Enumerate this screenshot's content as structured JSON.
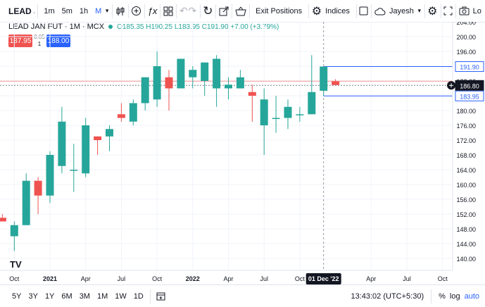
{
  "toolbar": {
    "symbol": "LEAD JAN FL",
    "intervals": [
      "1m",
      "5m",
      "1h",
      "M"
    ],
    "active_interval": "M",
    "exit_positions": "Exit Positions",
    "indices": "Indices",
    "user": "Jayesh",
    "log_label": "Lo",
    "icons": [
      "candles-icon",
      "add-indicator-icon",
      "formula-icon",
      "layout-grid-icon",
      "undo-icon",
      "redo-icon",
      "refresh-icon",
      "share-icon",
      "basket-icon",
      "settings-icon",
      "square-icon",
      "cloud-icon",
      "fullscreen-icon",
      "camera-icon"
    ]
  },
  "legend": {
    "title": "LEAD JAN FUT · 1M · MCX",
    "ohlc": "O185.35 H190.25 L183.95 C191.90 +7.00 (+3.79%)"
  },
  "bidask": {
    "bid": "187.95",
    "spread_top": "0.05",
    "spread_bottom": "1",
    "ask": "188.00"
  },
  "colors": {
    "up": "#26a69a",
    "down": "#ef5350",
    "accent": "#2962ff",
    "sell_line": "#ef5350"
  },
  "price_badges": {
    "high": "191.90",
    "current": "186.80",
    "low": "183.95"
  },
  "crosshair_date": "01 Dec '22",
  "bottom": {
    "ranges": [
      "5Y",
      "3Y",
      "1Y",
      "6M",
      "3M",
      "1M",
      "1W",
      "1D"
    ],
    "time": "13:43:02 (UTC+5:30)",
    "percent": "%",
    "log": "log",
    "auto": "auto"
  },
  "chart_data": {
    "type": "candlestick",
    "title": "LEAD JAN FUT · 1M · MCX",
    "y_ticks": [
      140,
      144,
      148,
      152,
      156,
      160,
      164,
      168,
      172,
      176,
      180,
      184,
      188,
      192,
      196,
      200,
      204
    ],
    "ylim": [
      137,
      206
    ],
    "x_tick_labels": [
      "Oct",
      "2021",
      "Apr",
      "Jul",
      "Oct",
      "2022",
      "Apr",
      "Jul",
      "Oct",
      "01 Dec '22",
      "Apr",
      "Jul",
      "Oct"
    ],
    "candles": [
      {
        "x": "Sep 2020",
        "o": 151,
        "h": 152,
        "l": 150,
        "c": 150
      },
      {
        "x": "Oct 2020",
        "o": 146,
        "h": 150,
        "l": 142,
        "c": 149
      },
      {
        "x": "Nov 2020",
        "o": 149,
        "h": 163,
        "l": 149,
        "c": 161
      },
      {
        "x": "Dec 2020",
        "o": 161,
        "h": 162,
        "l": 152,
        "c": 157
      },
      {
        "x": "Jan 2021",
        "o": 157,
        "h": 169,
        "l": 155,
        "c": 168
      },
      {
        "x": "Feb 2021",
        "o": 165,
        "h": 181,
        "l": 163,
        "c": 177
      },
      {
        "x": "Mar 2021",
        "o": 164,
        "h": 171,
        "l": 158,
        "c": 164
      },
      {
        "x": "Apr 2021",
        "o": 163,
        "h": 178,
        "l": 162,
        "c": 176
      },
      {
        "x": "May 2021",
        "o": 173,
        "h": 173,
        "l": 168,
        "c": 172
      },
      {
        "x": "Jun 2021",
        "o": 173,
        "h": 176,
        "l": 169,
        "c": 175
      },
      {
        "x": "Jul 2021",
        "o": 179,
        "h": 182,
        "l": 177,
        "c": 178
      },
      {
        "x": "Aug 2021",
        "o": 177,
        "h": 183,
        "l": 176,
        "c": 182
      },
      {
        "x": "Sep 2021",
        "o": 182,
        "h": 189,
        "l": 180,
        "c": 189
      },
      {
        "x": "Oct 2021",
        "o": 183,
        "h": 196,
        "l": 181,
        "c": 192
      },
      {
        "x": "Nov 2021",
        "o": 189,
        "h": 191,
        "l": 180,
        "c": 186
      },
      {
        "x": "Dec 2021",
        "o": 186,
        "h": 193,
        "l": 186,
        "c": 194
      },
      {
        "x": "Jan 2022",
        "o": 189,
        "h": 192,
        "l": 186,
        "c": 191
      },
      {
        "x": "Feb 2022",
        "o": 188,
        "h": 193,
        "l": 184,
        "c": 193
      },
      {
        "x": "Mar 2022",
        "o": 186,
        "h": 195,
        "l": 181,
        "c": 194
      },
      {
        "x": "Apr 2022",
        "o": 186,
        "h": 189,
        "l": 183,
        "c": 187
      },
      {
        "x": "May 2022",
        "o": 186,
        "h": 191,
        "l": 186,
        "c": 189
      },
      {
        "x": "Jun 2022",
        "o": 185,
        "h": 187,
        "l": 177,
        "c": 184
      },
      {
        "x": "Jul 2022",
        "o": 176,
        "h": 186,
        "l": 168,
        "c": 183
      },
      {
        "x": "Aug 2022",
        "o": 178,
        "h": 184,
        "l": 174,
        "c": 178
      },
      {
        "x": "Sep 2022",
        "o": 178,
        "h": 183,
        "l": 175,
        "c": 181
      },
      {
        "x": "Oct 2022",
        "o": 179,
        "h": 181,
        "l": 177,
        "c": 179
      },
      {
        "x": "Nov 2022",
        "o": 179,
        "h": 195,
        "l": 179,
        "c": 185
      },
      {
        "x": "Dec 2022",
        "o": 185.35,
        "h": 190.25,
        "l": 183.95,
        "c": 191.9
      },
      {
        "x": "Jan 2023",
        "o": 187.9,
        "h": 188.5,
        "l": 186.9,
        "c": 186.9
      }
    ],
    "horizontal_lines": {
      "high": 191.9,
      "low": 183.95,
      "current": 186.8,
      "sell": 187.95
    }
  }
}
